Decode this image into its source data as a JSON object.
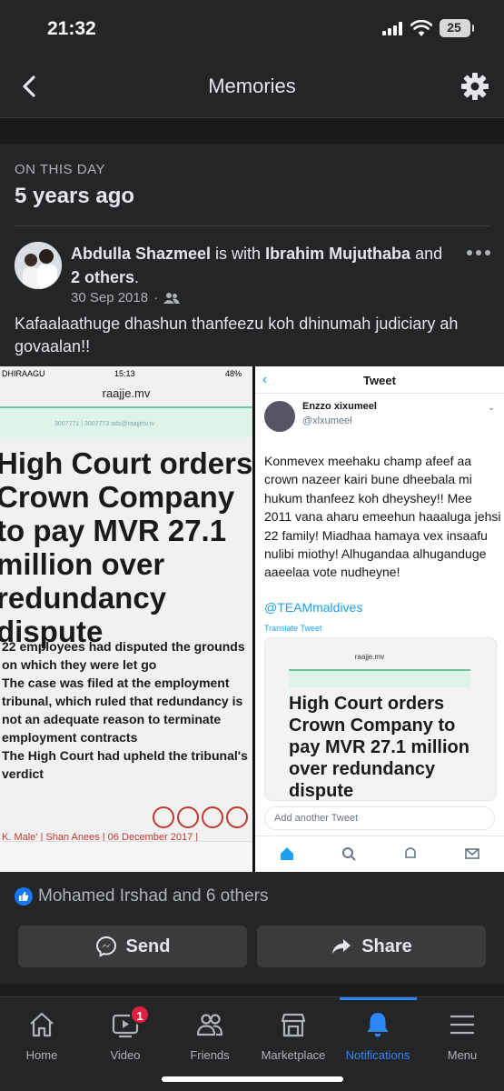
{
  "status_bar": {
    "time": "21:32",
    "battery": "25"
  },
  "header": {
    "title": "Memories"
  },
  "memory": {
    "section_label": "ON THIS DAY",
    "years_ago": "5 years ago",
    "post": {
      "author": "Abdulla Shazmeel",
      "with_text": " is with ",
      "tagged": "Ibrahim Mujuthaba",
      "and_text": " and ",
      "others": "2 others",
      "period": ".",
      "date": "30 Sep 2018",
      "dot": "·",
      "caption": "Kafaalaathuge dhashun thanfeezu koh dhinumah judiciary ah govaalan!!"
    }
  },
  "photo": {
    "left": {
      "carrier": "DHIRAAGU",
      "time": "15:13",
      "battery": "48%",
      "url": "raajje.mv",
      "banner_text": "3007771 | 3007773   ads@raajjetv.tv",
      "headline": "High Court orders Crown Company to pay MVR 27.1 million over redundancy dispute",
      "summary": [
        "22 employees had disputed the grounds on which they were let go",
        "The case was filed at the employment tribunal, which ruled that redundancy is not an adequate reason to terminate employment contracts",
        "The High Court had upheld the tribunal's verdict"
      ],
      "byline": "K. Male' | Shan Anees | 06 December 2017 |"
    },
    "right": {
      "nav_title": "Tweet",
      "name": "Enzzo xixumeel",
      "handle": "@xlxumeel",
      "text": "Konmevex meehaku champ afeef aa crown nazeer kairi bune dheebala mi hukum thanfeez koh dheyshey!! Mee 2011 vana aharu emeehun haaaluga jehsi 22 family! Miadhaa hamaya vex insaafu nulibi miothy! Alhugandaa alhuganduge aaeelaa vote nudheyne!",
      "mention": "@TEAMmaldives",
      "translate": "Translate Tweet",
      "embed_url": "raajje.mv",
      "embed_headline": "High Court orders Crown Company to pay MVR 27.1 million over redundancy dispute",
      "add_tweet_placeholder": "Add another Tweet"
    }
  },
  "reactions": {
    "text": "Mohamed Irshad and 6 others"
  },
  "actions": {
    "send": "Send",
    "share": "Share"
  },
  "bottom_nav": {
    "items": [
      {
        "label": "Home"
      },
      {
        "label": "Video",
        "badge": "1"
      },
      {
        "label": "Friends"
      },
      {
        "label": "Marketplace"
      },
      {
        "label": "Notifications"
      },
      {
        "label": "Menu"
      }
    ],
    "active": "Notifications"
  },
  "colors": {
    "accent": "#2d88ff",
    "badge": "#e41e3f",
    "background": "#242526",
    "like": "#1877f2"
  }
}
